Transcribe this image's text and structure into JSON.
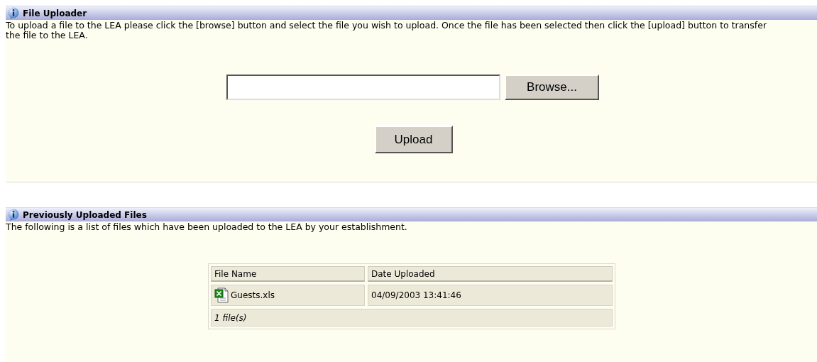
{
  "uploader": {
    "title": "File Uploader",
    "instructions": "To upload a file to the LEA please click the [browse] button and select the file you wish to upload. Once the file has been selected then click the [upload] button to transfer the file to the LEA.",
    "browse_button": "Browse...",
    "upload_button": "Upload"
  },
  "previous": {
    "title": "Previously Uploaded Files",
    "description": "The following is a list of files which have been uploaded to the LEA by your establishment.",
    "table": {
      "columns": [
        "File Name",
        "Date Uploaded"
      ],
      "rows": [
        {
          "file_name": "Guests.xls",
          "date_uploaded": "04/09/2003 13:41:46"
        }
      ],
      "footer": "1 file(s)"
    }
  }
}
